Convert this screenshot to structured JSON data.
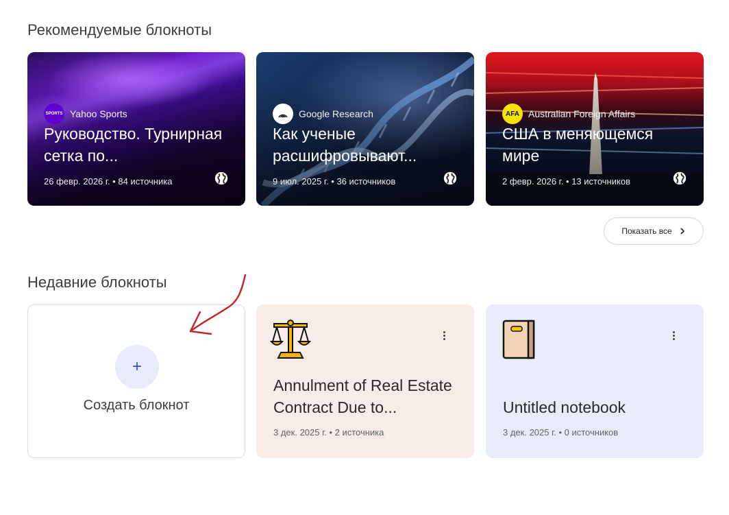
{
  "featured": {
    "title": "Рекомендуемые блокноты",
    "cards": [
      {
        "source": "Yahoo Sports",
        "source_logo_text": "SPORTS",
        "title": "Руководство. Турнирная сетка по...",
        "meta": "26 февр. 2026 г. • 84 источника",
        "icon": "globe-icon"
      },
      {
        "source": "Google Research",
        "title": "Как ученые расшифровывают...",
        "meta": "9 июл. 2025 г. • 36 источников",
        "icon": "globe-icon"
      },
      {
        "source": "Australian Foreign Affairs",
        "source_logo_text": "AFA",
        "title": "США в меняющемся мире",
        "meta": "2 февр. 2026 г. • 13 источников",
        "icon": "globe-icon"
      }
    ],
    "show_all_label": "Показать все"
  },
  "recent": {
    "title": "Недавние блокноты",
    "create_label": "Создать блокнот",
    "notebooks": [
      {
        "emoji": "scales-icon",
        "title": "Annulment of Real Estate Contract Due to...",
        "meta": "3 дек. 2025 г. • 2 источника"
      },
      {
        "emoji": "notebook-icon",
        "title": "Untitled notebook",
        "meta": "3 дек. 2025 г. • 0 источников"
      }
    ]
  },
  "colors": {
    "accent": "#3f51b5",
    "card_peach": "#f7ece8",
    "card_lavender": "#e9ecf8",
    "annotation_arrow": "#c0272d"
  }
}
